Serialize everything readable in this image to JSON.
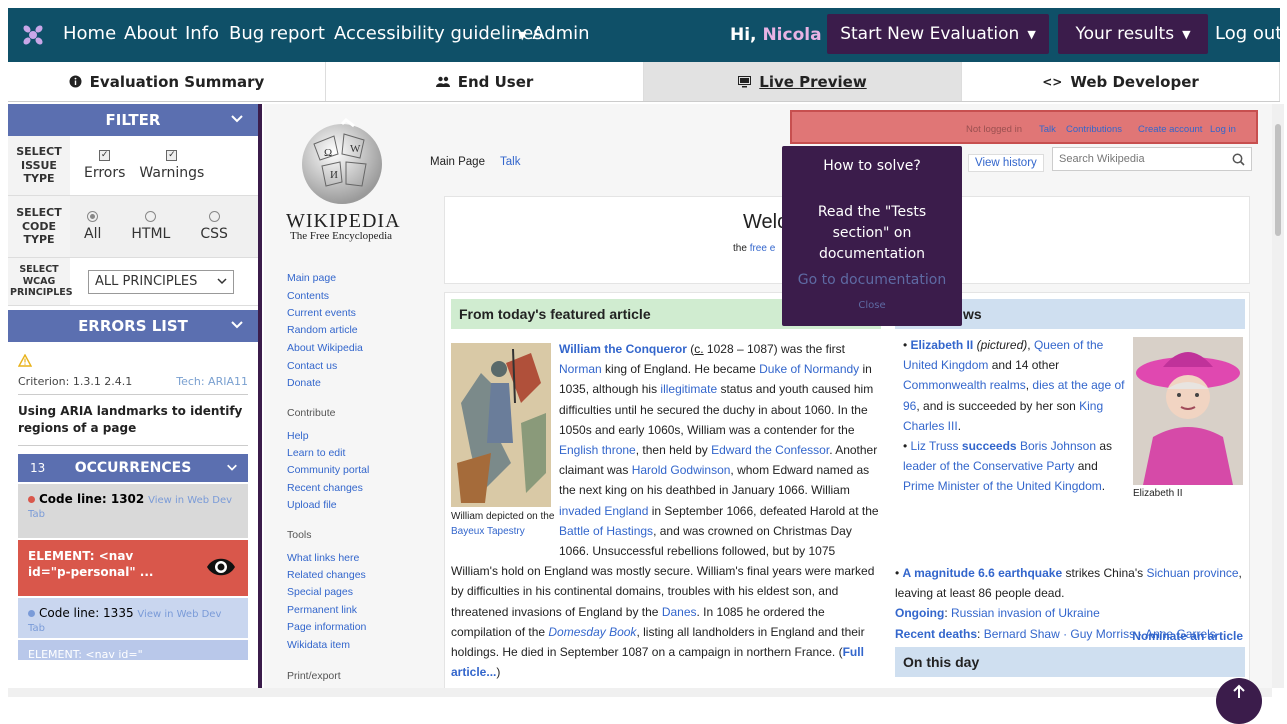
{
  "nav": {
    "links": [
      "Home",
      "About",
      "Info",
      "Bug report",
      "Accessibility guidelines"
    ],
    "admin": "Admin",
    "hi": "Hi,",
    "user": "Nicola",
    "start_eval": "Start New Evaluation",
    "results": "Your results",
    "logout": "Log out"
  },
  "tabs": [
    {
      "label": "Evaluation Summary",
      "icon": "info-circle-icon"
    },
    {
      "label": "End User",
      "icon": "users-icon"
    },
    {
      "label": "Live Preview",
      "icon": "monitor-icon"
    },
    {
      "label": "Web Developer",
      "icon": "code-icon"
    }
  ],
  "filter": {
    "title": "FILTER",
    "issue_type_label": [
      "SELECT",
      "ISSUE",
      "TYPE"
    ],
    "issue_types": [
      "Errors",
      "Warnings"
    ],
    "code_type_label": [
      "SELECT",
      "CODE",
      "TYPE"
    ],
    "code_types": [
      "All",
      "HTML",
      "CSS"
    ],
    "wcag_label": [
      "SELECT",
      "WCAG",
      "PRINCIPLES"
    ],
    "wcag_value": "ALL PRINCIPLES"
  },
  "errors": {
    "title": "ERRORS LIST",
    "criterion": "Criterion: 1.3.1 2.4.1",
    "tech": "Tech: ARIA11",
    "heading": "Using ARIA landmarks to identify regions of a page",
    "occ_count": "13",
    "occ_label": "OCCURRENCES",
    "occ1_label": "Code line: 1302",
    "occ1_link": "View in Web Dev Tab",
    "element": "ELEMENT: <nav id=\"p-personal\" ...",
    "occ2_label": "Code line: 1335",
    "occ2_link": "View in Web Dev Tab",
    "occ3": "ELEMENT: <nav id=\""
  },
  "wiki": {
    "name": "WIKIPEDIA",
    "sub": "The Free Encyclopedia",
    "nav1": [
      "Main page",
      "Contents",
      "Current events",
      "Random article",
      "About Wikipedia",
      "Contact us",
      "Donate"
    ],
    "contribute": "Contribute",
    "nav2": [
      "Help",
      "Learn to edit",
      "Community portal",
      "Recent changes",
      "Upload file"
    ],
    "tools": "Tools",
    "nav3": [
      "What links here",
      "Related changes",
      "Special pages",
      "Permanent link",
      "Page information",
      "Wikidata item"
    ],
    "printexport": "Print/export",
    "toplinks": [
      "Not logged in",
      "Talk",
      "Contributions",
      "Create account",
      "Log in"
    ],
    "tab_main": "Main Page",
    "tab_talk": "Talk",
    "view_history": "View history",
    "search": "Search Wikipedia",
    "welcome": "Welc",
    "welcome_sub_a": "the ",
    "welcome_sub_b": "free e",
    "fa_head": "From today's featured article",
    "news_head": "ws",
    "tap_caption_a": "William depicted on the ",
    "tap_caption_b": "Bayeux Tapestry",
    "fa": {
      "t1": "William the Conqueror",
      "t2": " (",
      "t3": "c.",
      "t4": " 1028 – 1087) was the first ",
      "t5": "Norman",
      "t6": " king of England. He became ",
      "t7": "Duke of Normandy",
      "t8": " in 1035, although his ",
      "t9": "illegitimate",
      "t10": " status and youth caused him difficulties until he secured the duchy in about 1060. In the 1050s and early 1060s, William was a contender for the ",
      "t11": "English throne",
      "t12": ", then held by ",
      "t13": "Edward the Confessor",
      "t14": ". Another claimant was ",
      "t15": "Harold Godwinson",
      "t16": ", whom Edward named as the next king on his deathbed in January 1066. William ",
      "t17": "invaded England",
      "t18": " in September 1066, defeated Harold at the ",
      "t19": "Battle of Hastings",
      "t20": ", and was crowned on Christmas Day 1066. Unsuccessful rebellions followed, but by 1075 William's hold on England was mostly secure. William's final years were marked by difficulties in his continental domains, troubles with his eldest son, and threatened invasions of England by the ",
      "t21": "Danes",
      "t22": ". In 1085 he ordered the compilation of the ",
      "t23": "Domesday Book",
      "t24": ", listing all landholders in England and their holdings. He died in September 1087 on a campaign in northern France. (",
      "t25": "Full article...",
      "t26": ")"
    },
    "news": {
      "n1a": "Elizabeth II",
      "n1b": " (pictured)",
      "n1c": ", ",
      "n1d": "Queen of the United Kingdom",
      "n1e": " and 14 other ",
      "n1f": "Commonwealth realms",
      "n1g": ", ",
      "n1h": "dies at the age of 96",
      "n1i": ", and is succeeded by her son ",
      "n1j": "King Charles III",
      "n1k": ".",
      "n2a": "Liz Truss",
      "n2b": " succeeds",
      "n2c": " Boris Johnson",
      "n2d": " as ",
      "n2e": "leader of the Conservative Party",
      "n2f": " and ",
      "n2g": "Prime Minister of the United Kingdom",
      "n2h": ".",
      "n3a": "A magnitude 6.6 earthquake",
      "n3b": " strikes China's ",
      "n3c": "Sichuan province",
      "n3d": ", leaving at least 86 people dead."
    },
    "queen_caption": "Elizabeth II",
    "ongoing_label": "Ongoing",
    "ongoing": "Russian invasion of Ukraine",
    "recent_label": "Recent deaths",
    "recent": "Bernard Shaw · Guy Morriss · Anne Garrels · Drummie Zeb · Esther Cooper Jackson · Mark Littell",
    "nominate": "Nominate an article",
    "otd": "On this day"
  },
  "tooltip": {
    "title": "How to solve?",
    "body": "Read the \"Tests section\" on documentation",
    "link": "Go to documentation",
    "close": "Close"
  },
  "colors": {
    "nav_bg": "#0f5068",
    "accent_purple": "#3b1c4b",
    "panel_blue": "#5b6fb0",
    "error_red": "#d9574b"
  }
}
